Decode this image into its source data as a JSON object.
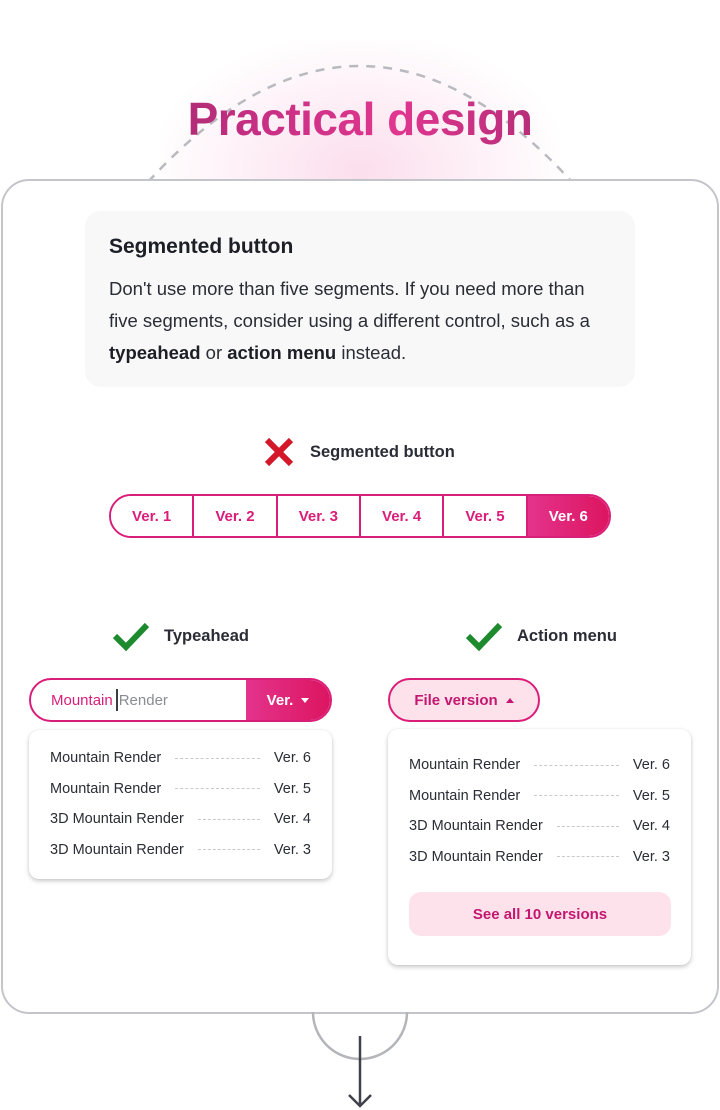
{
  "header": {
    "title": "Practical design"
  },
  "info_card": {
    "title": "Segmented button",
    "body_part1": "Don't use more than five segments. If you need more than five segments, consider using a different control, such as a ",
    "body_bold1": "typeahead",
    "body_part2": " or ",
    "body_bold2": "action menu",
    "body_part3": " instead."
  },
  "bad_example": {
    "icon": "x-icon",
    "status_color": "#d3182a",
    "label": "Segmented button",
    "segments": [
      "Ver. 1",
      "Ver. 2",
      "Ver. 3",
      "Ver. 4",
      "Ver. 5",
      "Ver. 6"
    ],
    "selected_segment": "Ver. 6"
  },
  "typeahead_example": {
    "icon": "check-icon",
    "status_color": "#1e8a2e",
    "label": "Typeahead",
    "input_typed": "Mountain",
    "input_hint": "Render",
    "button_label": "Ver.",
    "button_icon": "caret-down-icon",
    "options": [
      {
        "name": "Mountain Render",
        "version": "Ver. 6"
      },
      {
        "name": "Mountain Render",
        "version": "Ver. 5"
      },
      {
        "name": "3D Mountain Render",
        "version": "Ver. 4"
      },
      {
        "name": "3D Mountain Render",
        "version": "Ver. 3"
      }
    ]
  },
  "action_menu_example": {
    "icon": "check-icon",
    "status_color": "#1e8a2e",
    "label": "Action menu",
    "button_label": "File version",
    "button_icon": "caret-up-icon",
    "options": [
      {
        "name": "Mountain Render",
        "version": "Ver. 6"
      },
      {
        "name": "Mountain Render",
        "version": "Ver. 5"
      },
      {
        "name": "3D Mountain Render",
        "version": "Ver. 4"
      },
      {
        "name": "3D Mountain Render",
        "version": "Ver. 3"
      }
    ],
    "see_all_label": "See all 10 versions"
  },
  "colors": {
    "accent": "#d91e7a",
    "accent_light": "#fde2ec",
    "frame_border": "#c4c5ca"
  },
  "footer": {
    "icon": "arrow-down-icon"
  }
}
